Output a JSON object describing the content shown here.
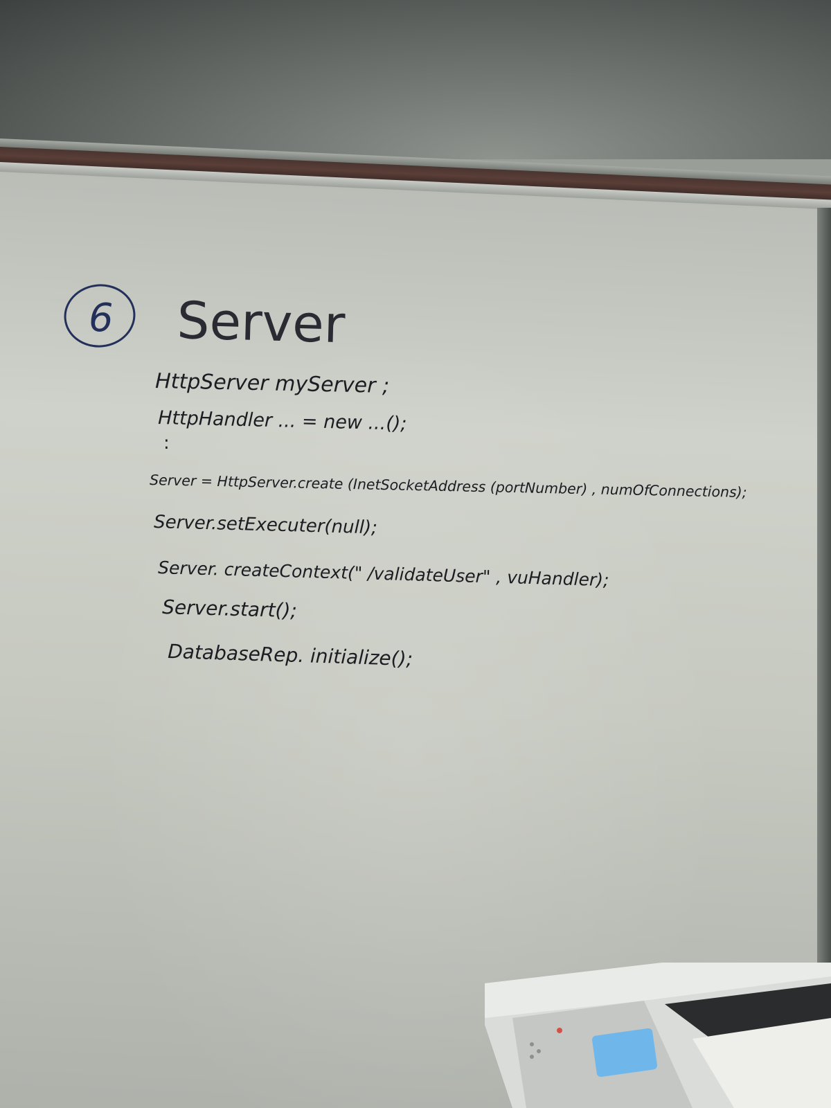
{
  "whiteboard": {
    "step_number": "6",
    "title": "Server",
    "lines": [
      "HttpServer    myServer ;",
      "HttpHandler ... = new ...();",
      ":",
      "Server = HttpServer.create (InetSocketAddress (portNumber) , numOfConnections);",
      "Server.setExecuter(null);",
      "Server. createContext(\" /validateUser\" , vuHandler);",
      "Server.start();",
      "DatabaseRep. initialize();"
    ]
  },
  "colors": {
    "ink_black": "#1c1c22",
    "ink_blue": "#22305a",
    "board": "#c8cbc3",
    "rail": "#4a3530",
    "printer_display": "#6fb6ea"
  }
}
